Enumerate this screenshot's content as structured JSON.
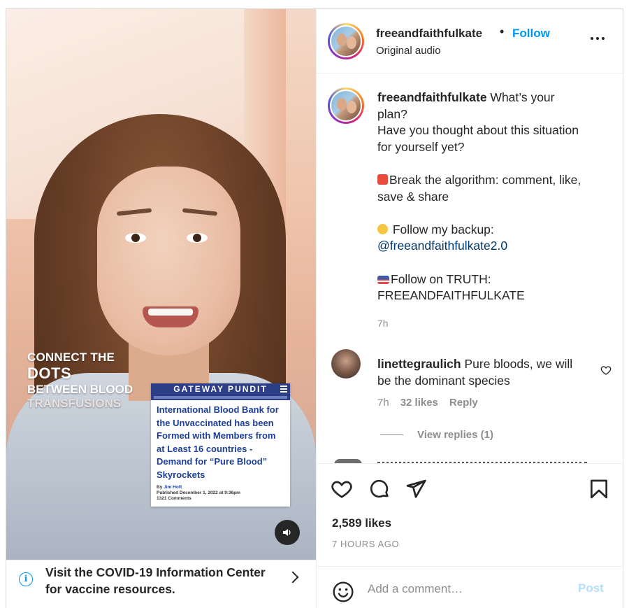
{
  "media": {
    "overlay_lines": [
      "CONNECT THE",
      "DOTS",
      "BETWEEN BLOOD",
      "TRANSFUSIONS"
    ],
    "article": {
      "source": "GATEWAY PUNDIT",
      "title": "International Blood Bank for the Unvaccinated has been Formed with Members from at Least 16 countries - Demand for “Pure Blood” Skyrockets",
      "byline_prefix": "By ",
      "author": "Jim Hoft",
      "published": "Published December 1, 2022 at 9:36pm",
      "comments": "1321 Comments"
    },
    "sound_icon": "speaker-icon"
  },
  "covid_banner": {
    "text": "Visit the COVID-19 Information Center for vaccine resources.",
    "icon": "info-icon"
  },
  "header": {
    "username": "freeandfaithfulkate",
    "separator": "•",
    "follow_label": "Follow",
    "audio": "Original audio"
  },
  "caption": {
    "username": "freeandfaithfulkate",
    "line1": " What’s your plan?\nHave you thought about this situation for yourself yet?\n\n",
    "line2": "Break the algorithm: comment, like, save & share\n\n",
    "line3": " Follow my backup:\n",
    "mention": "@freeandfaithfulkate2.0",
    "line4": "\n\n",
    "line5": "Follow on TRUTH:\nFREEANDFAITHFULKATE",
    "time": "7h"
  },
  "comment1": {
    "username": "linettegraulich",
    "text": " Pure bloods, we will be the dominant species",
    "time": "7h",
    "likes": "32 likes",
    "reply_label": "Reply",
    "view_replies": "View replies (1)"
  },
  "actions": {
    "likes": "2,589 likes",
    "time_ago": "7 HOURS AGO"
  },
  "add_comment": {
    "placeholder": "Add a comment…",
    "post_label": "Post"
  },
  "colors": {
    "link_blue": "#0095f6",
    "mention": "#00376b",
    "muted": "#8e8e8e",
    "post_disabled": "#b2dffc"
  }
}
